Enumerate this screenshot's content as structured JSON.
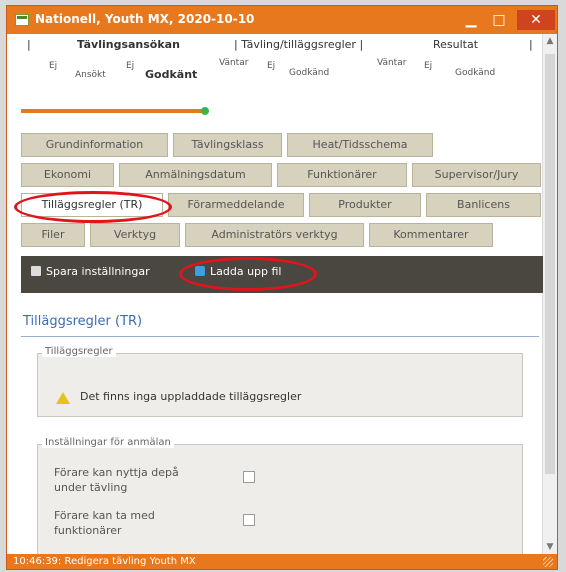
{
  "window": {
    "title": "Nationell, Youth MX, 2020-10-10",
    "min_glyph": "▁",
    "max_glyph": "□",
    "close_glyph": "✕"
  },
  "top_tabs": [
    {
      "label": "|"
    },
    {
      "label": "Tävlingsansökan"
    },
    {
      "label": "| Tävling/tilläggsregler |"
    },
    {
      "label": "Resultat"
    },
    {
      "label": "|"
    }
  ],
  "progress_steps": [
    {
      "label": "Ej"
    },
    {
      "label": "Ansökt"
    },
    {
      "label": "Ej"
    },
    {
      "label": "Godkänt"
    },
    {
      "label": "Väntar"
    },
    {
      "label": "Ej"
    },
    {
      "label": "Godkänd"
    },
    {
      "label": "Väntar"
    },
    {
      "label": "Ej"
    },
    {
      "label": "Godkänd"
    }
  ],
  "progress": {
    "current_step": 3,
    "total_steps": 10
  },
  "tab_rows": [
    [
      {
        "label": "Grundinformation"
      },
      {
        "label": "Tävlingsklass"
      },
      {
        "label": "Heat/Tidsschema"
      }
    ],
    [
      {
        "label": "Ekonomi"
      },
      {
        "label": "Anmälningsdatum"
      },
      {
        "label": "Funktionärer"
      },
      {
        "label": "Supervisor/Jury"
      }
    ],
    [
      {
        "label": "Tilläggsregler (TR)"
      },
      {
        "label": "Förarmeddelande"
      },
      {
        "label": "Produkter"
      },
      {
        "label": "Banlicens"
      }
    ],
    [
      {
        "label": "Filer"
      },
      {
        "label": "Verktyg"
      },
      {
        "label": "Administratörs verktyg"
      },
      {
        "label": "Kommentarer"
      }
    ]
  ],
  "active_tab": "Tilläggsregler (TR)",
  "toolbar": {
    "save_label": "Spara inställningar",
    "upload_label": "Ladda upp fil"
  },
  "section": {
    "title": "Tilläggsregler (TR)",
    "rules_legend": "Tilläggsregler",
    "rules_message": "Det finns inga uppladdade tilläggsregler",
    "settings_legend": "Inställningar för anmälan",
    "settings": [
      {
        "label": "Förare kan nyttja depå under tävling",
        "checked": false
      },
      {
        "label": "Förare kan ta med funktionärer",
        "checked": false
      }
    ]
  },
  "status": {
    "text": "10:46:39: Redigera tävling Youth MX"
  },
  "colors": {
    "titlebar": "#e8781e",
    "toolbar": "#4a4640",
    "tab": "#d7d2bd",
    "section_title": "#3a6db5",
    "annotation": "#e0141a"
  }
}
